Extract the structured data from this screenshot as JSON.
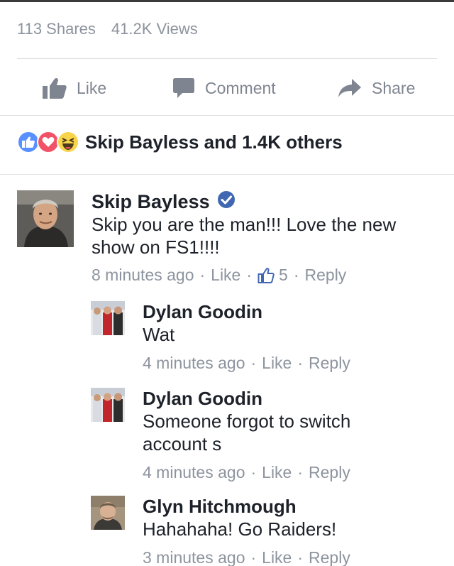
{
  "stats": {
    "shares": "113 Shares",
    "views": "41.2K Views"
  },
  "actions": {
    "like": "Like",
    "comment": "Comment",
    "share": "Share"
  },
  "reactions": {
    "summary": "Skip Bayless and 1.4K others"
  },
  "colors": {
    "accent": "#5890ff",
    "love": "#f25268",
    "haha": "#f7d44a",
    "muted": "#8d949e",
    "verified": "#4267b2"
  },
  "comments": [
    {
      "name": "Skip Bayless",
      "verified": true,
      "text": "Skip you are the man!!! Love the new show on FS1!!!!",
      "time": "8 minutes ago",
      "like": "Like",
      "like_count": "5",
      "reply": "Reply"
    },
    {
      "name": "Dylan Goodin",
      "text": "Wat",
      "time": "4 minutes ago",
      "like": "Like",
      "reply": "Reply"
    },
    {
      "name": "Dylan Goodin",
      "text": "Someone forgot to switch account s",
      "time": "4 minutes ago",
      "like": "Like",
      "reply": "Reply"
    },
    {
      "name": "Glyn Hitchmough",
      "text": "Hahahaha! Go Raiders!",
      "time": "3 minutes ago",
      "like": "Like",
      "reply": "Reply"
    }
  ]
}
